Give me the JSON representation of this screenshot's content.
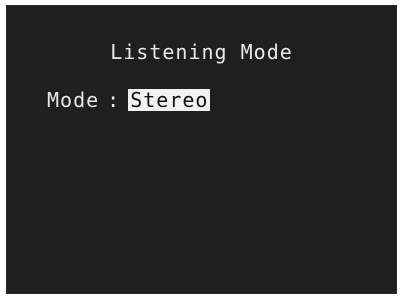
{
  "screen": {
    "title": "Listening Mode",
    "mode_label": "Mode",
    "separator": ":",
    "mode_value": "Stereo",
    "colors": {
      "background": "#1f1f1f",
      "text": "#e8e8e8",
      "highlight_bg": "#f2f2f2",
      "highlight_text": "#111111"
    }
  }
}
